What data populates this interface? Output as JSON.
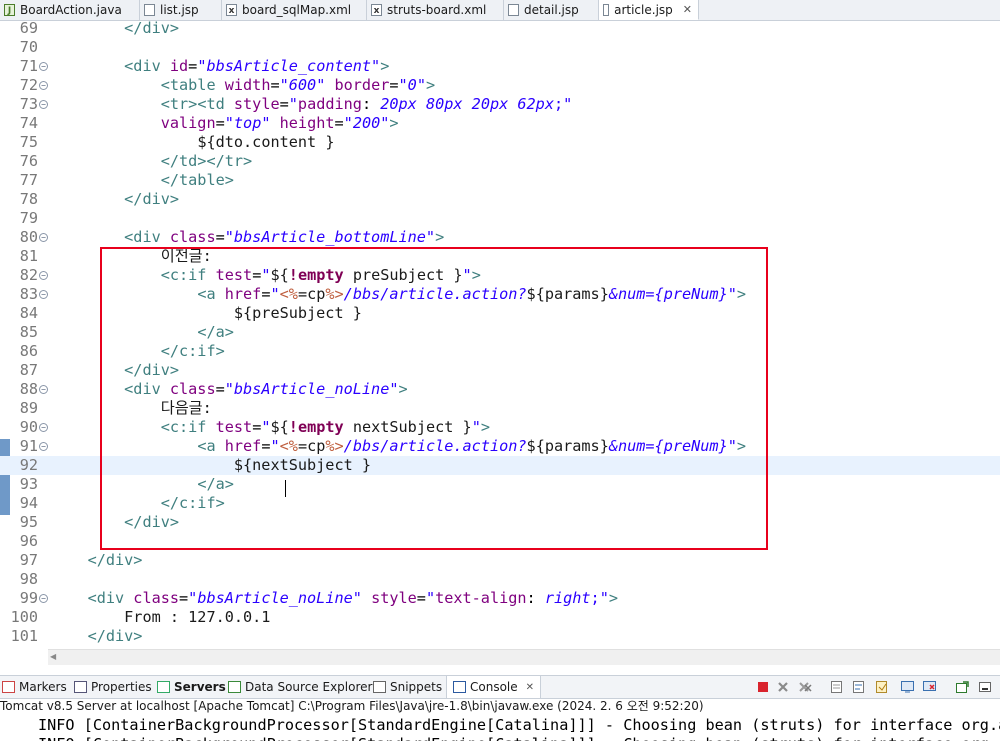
{
  "tabs": [
    {
      "label": "BoardAction.java",
      "icon": "java-file-icon"
    },
    {
      "label": "list.jsp",
      "icon": "jsp-file-icon"
    },
    {
      "label": "board_sqlMap.xml",
      "icon": "xml-file-icon"
    },
    {
      "label": "struts-board.xml",
      "icon": "xml-file-icon"
    },
    {
      "label": "detail.jsp",
      "icon": "jsp-file-icon"
    },
    {
      "label": "article.jsp",
      "icon": "jsp-file-icon",
      "active": true
    }
  ],
  "editor": {
    "current_line": 92,
    "lines": [
      {
        "n": "69",
        "tokens": [
          [
            "        ",
            ""
          ],
          [
            "</div>",
            "t"
          ]
        ]
      },
      {
        "n": "70",
        "tokens": []
      },
      {
        "n": "71",
        "fold": true,
        "tokens": [
          [
            "        ",
            ""
          ],
          [
            "<div ",
            "t"
          ],
          [
            "id",
            "a"
          ],
          [
            "=",
            ""
          ],
          [
            "\"bbsArticle_content\"",
            "v"
          ],
          [
            ">",
            "t"
          ]
        ]
      },
      {
        "n": "72",
        "fold": true,
        "tokens": [
          [
            "            ",
            ""
          ],
          [
            "<table ",
            "t"
          ],
          [
            "width",
            "a"
          ],
          [
            "=",
            ""
          ],
          [
            "\"600\"",
            "v"
          ],
          [
            " ",
            ""
          ],
          [
            "border",
            "a"
          ],
          [
            "=",
            ""
          ],
          [
            "\"0\"",
            "v"
          ],
          [
            ">",
            "t"
          ]
        ]
      },
      {
        "n": "73",
        "fold": true,
        "tokens": [
          [
            "            ",
            ""
          ],
          [
            "<tr>",
            "t"
          ],
          [
            "<td ",
            "t"
          ],
          [
            "style",
            "a"
          ],
          [
            "=",
            ""
          ],
          [
            "\"",
            "q"
          ],
          [
            "padding",
            "a"
          ],
          [
            ": ",
            ""
          ],
          [
            "20px 80px 20px 62px",
            "v"
          ],
          [
            ";\"",
            "q"
          ]
        ]
      },
      {
        "n": "74",
        "tokens": [
          [
            "            ",
            ""
          ],
          [
            "valign",
            "a"
          ],
          [
            "=",
            ""
          ],
          [
            "\"top\"",
            "v"
          ],
          [
            " ",
            ""
          ],
          [
            "height",
            "a"
          ],
          [
            "=",
            ""
          ],
          [
            "\"200\"",
            "v"
          ],
          [
            ">",
            "t"
          ]
        ]
      },
      {
        "n": "75",
        "tokens": [
          [
            "                ",
            ""
          ],
          [
            "${dto.content }",
            "n"
          ]
        ]
      },
      {
        "n": "76",
        "tokens": [
          [
            "            ",
            ""
          ],
          [
            "</td>",
            "t"
          ],
          [
            "</tr>",
            "t"
          ]
        ]
      },
      {
        "n": "77",
        "tokens": [
          [
            "            ",
            ""
          ],
          [
            "</table>",
            "t"
          ]
        ]
      },
      {
        "n": "78",
        "tokens": [
          [
            "        ",
            ""
          ],
          [
            "</div>",
            "t"
          ]
        ]
      },
      {
        "n": "79",
        "tokens": []
      },
      {
        "n": "80",
        "fold": true,
        "tokens": [
          [
            "        ",
            ""
          ],
          [
            "<div ",
            "t"
          ],
          [
            "class",
            "a"
          ],
          [
            "=",
            ""
          ],
          [
            "\"bbsArticle_bottomLine\"",
            "v"
          ],
          [
            ">",
            "t"
          ]
        ]
      },
      {
        "n": "81",
        "tokens": [
          [
            "            ",
            ""
          ],
          [
            "이전글:",
            "n"
          ]
        ]
      },
      {
        "n": "82",
        "fold": true,
        "tokens": [
          [
            "            ",
            ""
          ],
          [
            "<c:if ",
            "t"
          ],
          [
            "test",
            "a"
          ],
          [
            "=",
            ""
          ],
          [
            "\"",
            "q"
          ],
          [
            "${",
            "n"
          ],
          [
            "!empty",
            "k"
          ],
          [
            " preSubject }",
            "n"
          ],
          [
            "\"",
            "q"
          ],
          [
            ">",
            "t"
          ]
        ]
      },
      {
        "n": "83",
        "fold": true,
        "tokens": [
          [
            "                ",
            ""
          ],
          [
            "<a ",
            "t"
          ],
          [
            "href",
            "a"
          ],
          [
            "=",
            ""
          ],
          [
            "\"",
            "q"
          ],
          [
            "<%",
            "d"
          ],
          [
            "=cp",
            "n"
          ],
          [
            "%>",
            "d"
          ],
          [
            "/bbs/article.action?",
            "v"
          ],
          [
            "${params}",
            "n"
          ],
          [
            "&num={preNum}",
            "v"
          ],
          [
            "\"",
            "q"
          ],
          [
            ">",
            "t"
          ]
        ]
      },
      {
        "n": "84",
        "tokens": [
          [
            "                    ",
            ""
          ],
          [
            "${preSubject }",
            "n"
          ]
        ]
      },
      {
        "n": "85",
        "tokens": [
          [
            "                ",
            ""
          ],
          [
            "</a>",
            "t"
          ]
        ]
      },
      {
        "n": "86",
        "tokens": [
          [
            "            ",
            ""
          ],
          [
            "</c:if>",
            "t"
          ]
        ]
      },
      {
        "n": "87",
        "tokens": [
          [
            "        ",
            ""
          ],
          [
            "</div>",
            "t"
          ]
        ]
      },
      {
        "n": "88",
        "fold": true,
        "tokens": [
          [
            "        ",
            ""
          ],
          [
            "<div ",
            "t"
          ],
          [
            "class",
            "a"
          ],
          [
            "=",
            ""
          ],
          [
            "\"bbsArticle_noLine\"",
            "v"
          ],
          [
            ">",
            "t"
          ]
        ]
      },
      {
        "n": "89",
        "tokens": [
          [
            "            ",
            ""
          ],
          [
            "다음글:",
            "n"
          ]
        ]
      },
      {
        "n": "90",
        "fold": true,
        "tokens": [
          [
            "            ",
            ""
          ],
          [
            "<c:if ",
            "t"
          ],
          [
            "test",
            "a"
          ],
          [
            "=",
            ""
          ],
          [
            "\"",
            "q"
          ],
          [
            "${",
            "n"
          ],
          [
            "!empty",
            "k"
          ],
          [
            " nextSubject }",
            "n"
          ],
          [
            "\"",
            "q"
          ],
          [
            ">",
            "t"
          ]
        ]
      },
      {
        "n": "91",
        "fold": true,
        "tokens": [
          [
            "                ",
            ""
          ],
          [
            "<a ",
            "t"
          ],
          [
            "href",
            "a"
          ],
          [
            "=",
            ""
          ],
          [
            "\"",
            "q"
          ],
          [
            "<%",
            "d"
          ],
          [
            "=cp",
            "n"
          ],
          [
            "%>",
            "d"
          ],
          [
            "/bbs/article.action?",
            "v"
          ],
          [
            "${params}",
            "n"
          ],
          [
            "&num={preNum}",
            "v"
          ],
          [
            "\"",
            "q"
          ],
          [
            ">",
            "t"
          ]
        ]
      },
      {
        "n": "92",
        "tokens": [
          [
            "                    ",
            ""
          ],
          [
            "${nextSubject }",
            "n"
          ]
        ]
      },
      {
        "n": "93",
        "tokens": [
          [
            "                ",
            ""
          ],
          [
            "</a>",
            "t"
          ]
        ]
      },
      {
        "n": "94",
        "tokens": [
          [
            "            ",
            ""
          ],
          [
            "</c:if>",
            "t"
          ]
        ]
      },
      {
        "n": "95",
        "tokens": [
          [
            "        ",
            ""
          ],
          [
            "</div>",
            "t"
          ]
        ]
      },
      {
        "n": "96",
        "tokens": []
      },
      {
        "n": "97",
        "tokens": [
          [
            "    ",
            ""
          ],
          [
            "</div>",
            "t"
          ]
        ]
      },
      {
        "n": "98",
        "tokens": []
      },
      {
        "n": "99",
        "fold": true,
        "tokens": [
          [
            "    ",
            ""
          ],
          [
            "<div ",
            "t"
          ],
          [
            "class",
            "a"
          ],
          [
            "=",
            ""
          ],
          [
            "\"bbsArticle_noLine\"",
            "v"
          ],
          [
            " ",
            ""
          ],
          [
            "style",
            "a"
          ],
          [
            "=",
            ""
          ],
          [
            "\"",
            "q"
          ],
          [
            "text-align",
            "a"
          ],
          [
            ": ",
            ""
          ],
          [
            "right",
            "v"
          ],
          [
            ";\"",
            "q"
          ],
          [
            ">",
            "t"
          ]
        ]
      },
      {
        "n": "100",
        "tokens": [
          [
            "        ",
            ""
          ],
          [
            "From : 127.0.0.1",
            "n"
          ]
        ]
      },
      {
        "n": "101",
        "tokens": [
          [
            "    ",
            ""
          ],
          [
            "</div>",
            "t"
          ]
        ]
      }
    ]
  },
  "views": [
    {
      "label": "Markers",
      "icon": "markers-icon"
    },
    {
      "label": "Properties",
      "icon": "properties-icon"
    },
    {
      "label": "Servers",
      "icon": "servers-icon",
      "bold": true
    },
    {
      "label": "Data Source Explorer",
      "icon": "data-source-icon"
    },
    {
      "label": "Snippets",
      "icon": "snippets-icon"
    },
    {
      "label": "Console",
      "icon": "console-icon",
      "active": true
    }
  ],
  "console": {
    "header": "Tomcat v8.5 Server at localhost [Apache Tomcat] C:\\Program Files\\Java\\jre-1.8\\bin\\javaw.exe  (2024. 2. 6 오전 9:52:20)",
    "lines": [
      "INFO [ContainerBackgroundProcessor[StandardEngine[Catalina]]] - Choosing bean (struts) for interface org.ap",
      "INFO [ContainerBackgroundProcessor[StandardEngine[Catalina]]] - Choosing bean (struts) for interface org.ap"
    ]
  },
  "colors": {
    "highlight_box": "#e8001c",
    "current_line": "#e8f2fe",
    "change_bar": "#6f99c8"
  }
}
